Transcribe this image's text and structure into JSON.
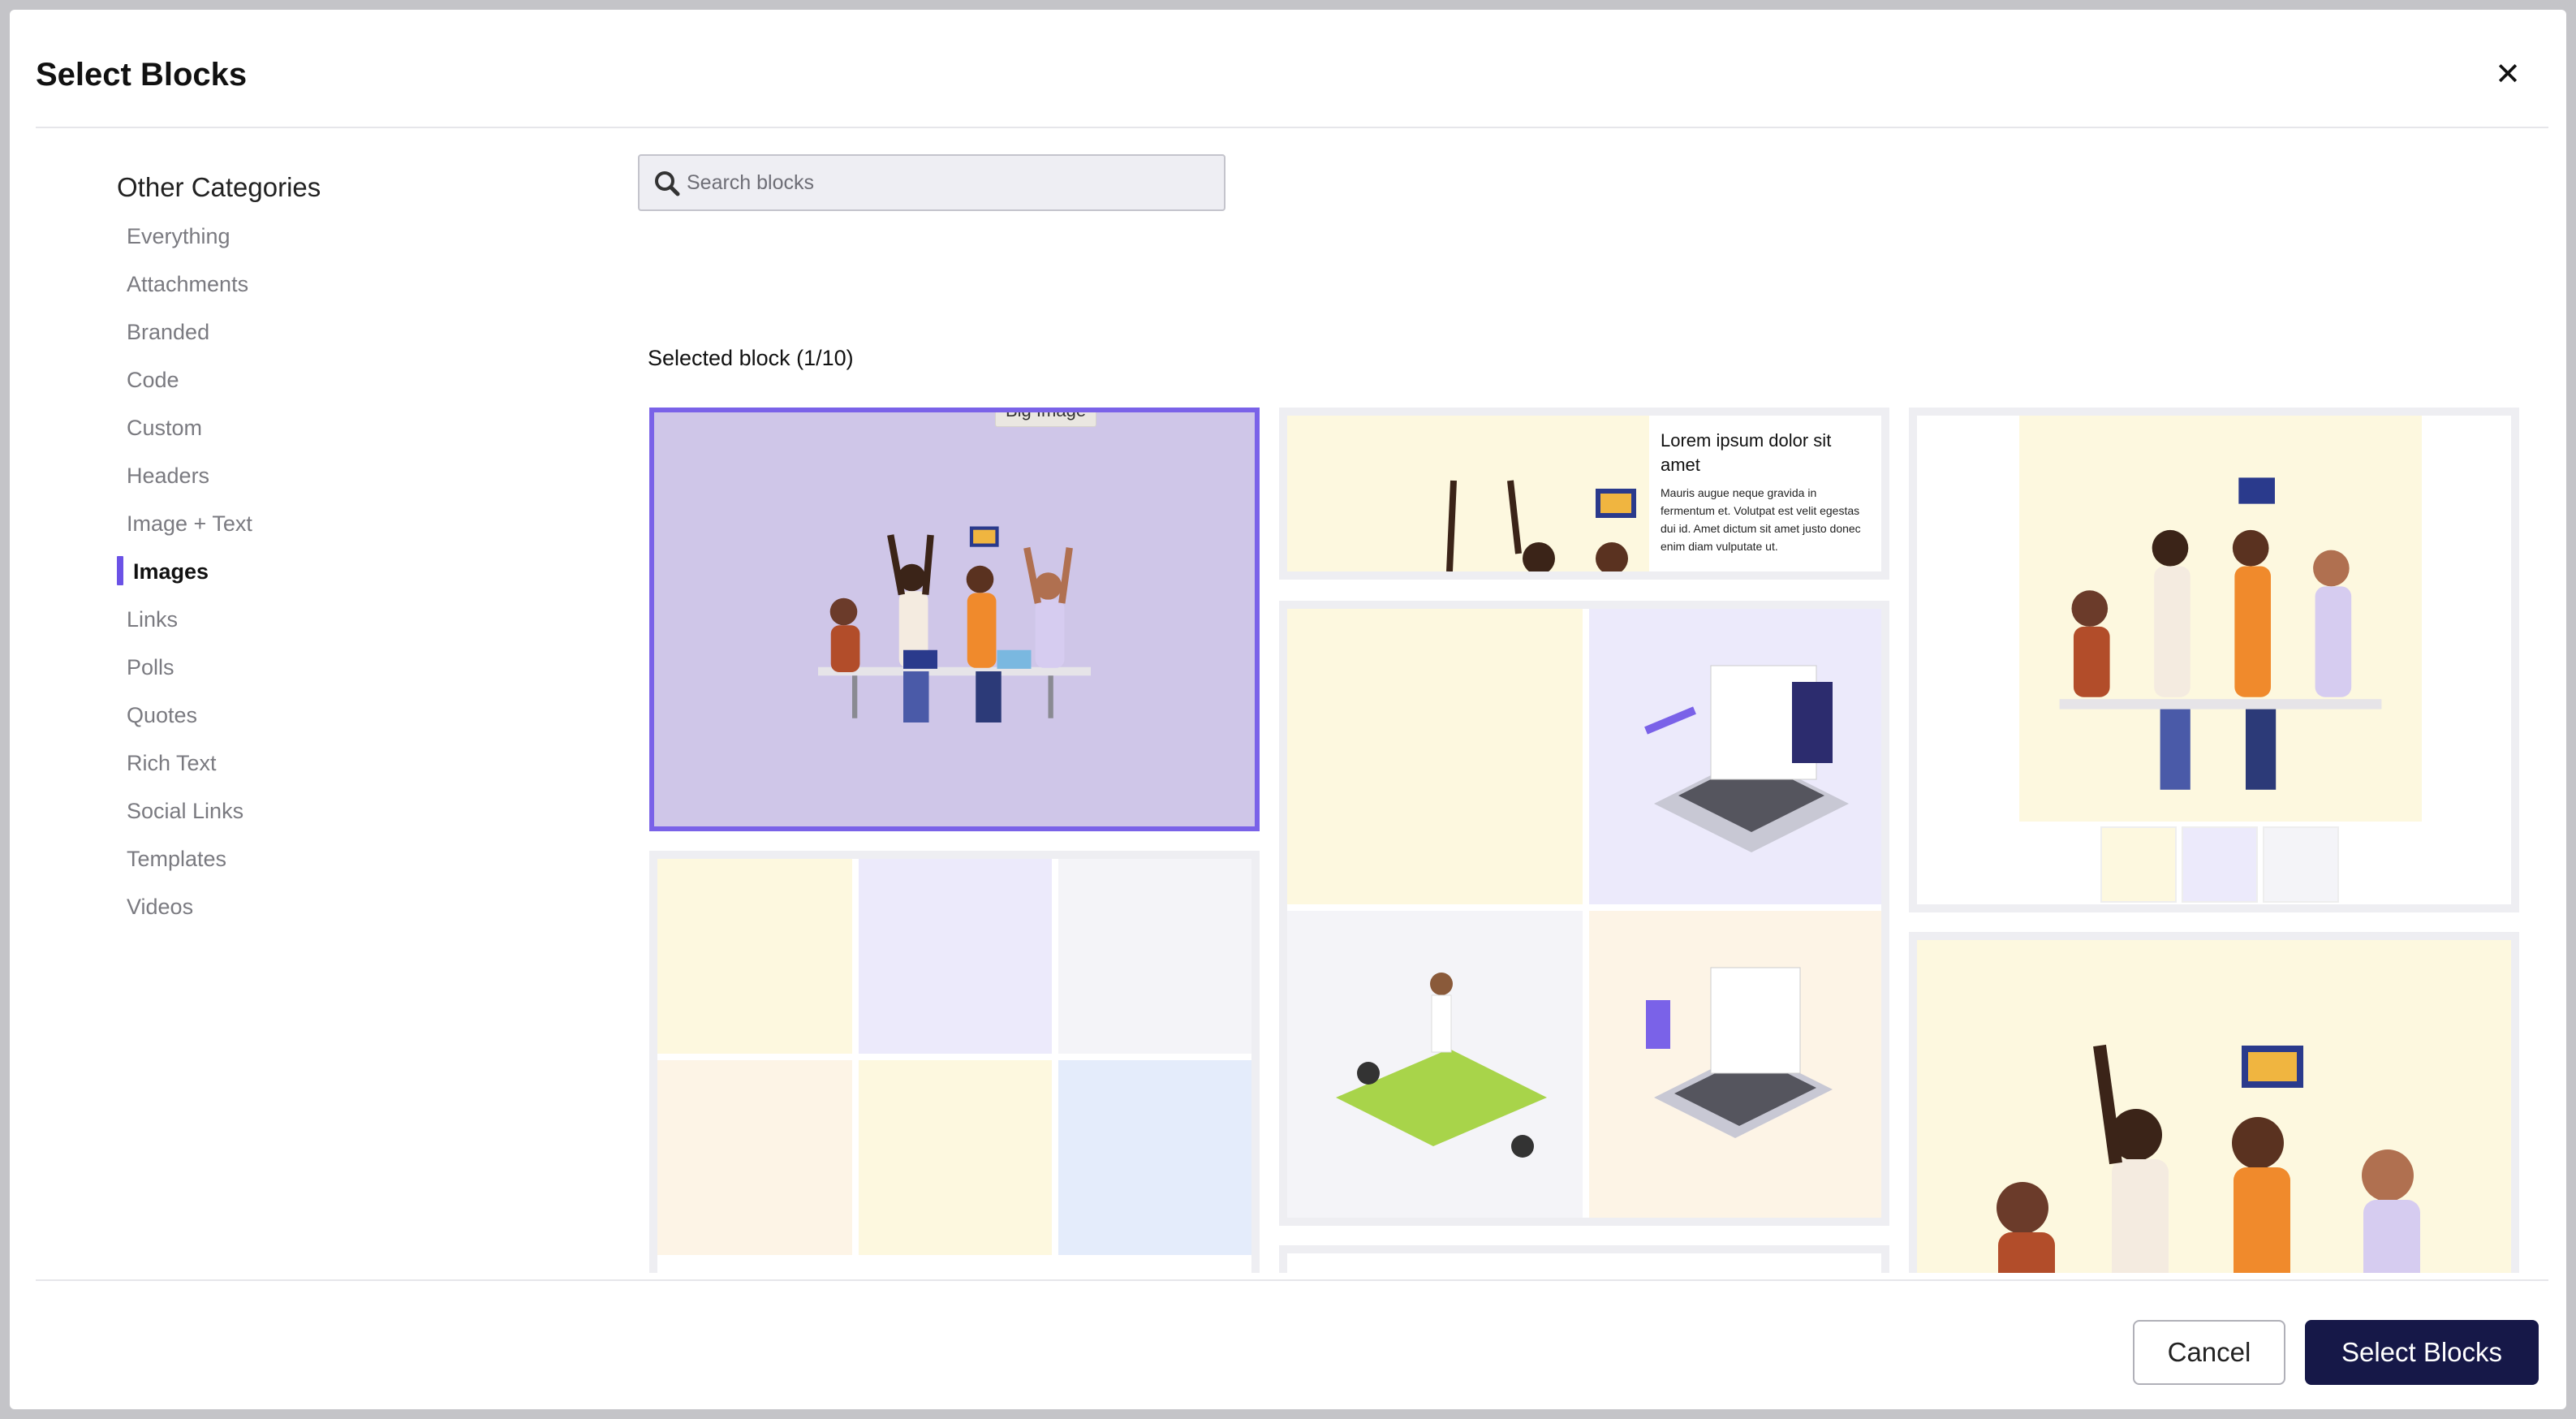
{
  "modal": {
    "title": "Select Blocks"
  },
  "sidebar": {
    "heading": "Other Categories",
    "items": [
      {
        "label": "Everything"
      },
      {
        "label": "Attachments"
      },
      {
        "label": "Branded"
      },
      {
        "label": "Code"
      },
      {
        "label": "Custom"
      },
      {
        "label": "Headers"
      },
      {
        "label": "Image + Text"
      },
      {
        "label": "Images"
      },
      {
        "label": "Links"
      },
      {
        "label": "Polls"
      },
      {
        "label": "Quotes"
      },
      {
        "label": "Rich Text"
      },
      {
        "label": "Social Links"
      },
      {
        "label": "Templates"
      },
      {
        "label": "Videos"
      }
    ],
    "active_label": "Images"
  },
  "search": {
    "placeholder": "Search blocks",
    "value": ""
  },
  "selection": {
    "label": "Selected block (1/10)"
  },
  "tooltip": {
    "label": "Big Image"
  },
  "text_block": {
    "heading": "Lorem ipsum dolor sit amet",
    "body": "Mauris augue neque gravida in fermentum et. Volutpat est velit egestas dui id. Amet dictum sit amet justo donec enim diam vulputate ut."
  },
  "footer": {
    "cancel_label": "Cancel",
    "confirm_label": "Select Blocks"
  },
  "colors": {
    "accent": "#6b52e6",
    "primary_button": "#161848",
    "selected_bg": "#cfc6e8"
  }
}
